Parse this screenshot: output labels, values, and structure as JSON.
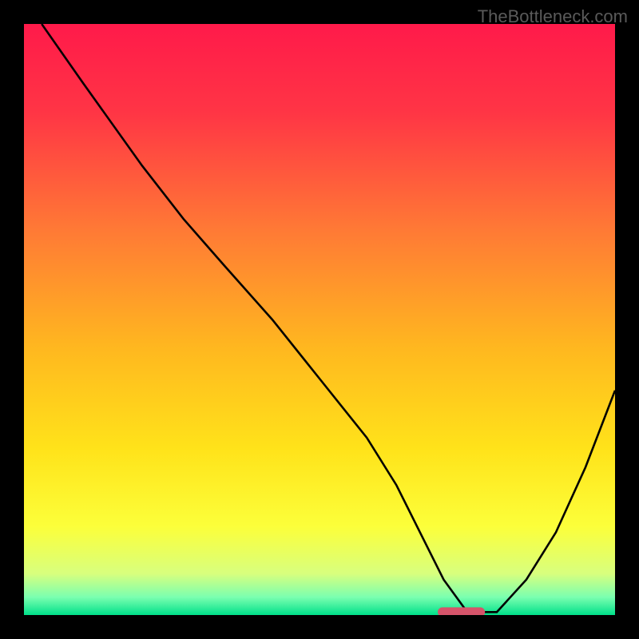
{
  "watermark": "TheBottleneck.com",
  "chart_data": {
    "type": "line",
    "title": "",
    "xlabel": "",
    "ylabel": "",
    "xlim": [
      0,
      100
    ],
    "ylim": [
      0,
      100
    ],
    "grid": false,
    "background_gradient": {
      "stops": [
        {
          "pos": 0.0,
          "color": "#ff1a4a"
        },
        {
          "pos": 0.15,
          "color": "#ff3545"
        },
        {
          "pos": 0.35,
          "color": "#ff7a35"
        },
        {
          "pos": 0.55,
          "color": "#ffb81f"
        },
        {
          "pos": 0.72,
          "color": "#ffe31a"
        },
        {
          "pos": 0.85,
          "color": "#fcff3a"
        },
        {
          "pos": 0.93,
          "color": "#d8ff7e"
        },
        {
          "pos": 0.97,
          "color": "#7affb0"
        },
        {
          "pos": 1.0,
          "color": "#00e08a"
        }
      ]
    },
    "series": [
      {
        "name": "bottleneck-curve",
        "color": "#000000",
        "x": [
          3,
          10,
          20,
          27,
          34,
          42,
          50,
          58,
          63,
          67,
          71,
          75,
          80,
          85,
          90,
          95,
          100
        ],
        "y": [
          100,
          90,
          76,
          67,
          59,
          50,
          40,
          30,
          22,
          14,
          6,
          0.5,
          0.5,
          6,
          14,
          25,
          38
        ]
      }
    ],
    "marker": {
      "name": "optimal-range",
      "shape": "rounded-bar",
      "color": "#d6546a",
      "x_start": 70,
      "x_end": 78,
      "y": 0.5
    }
  }
}
